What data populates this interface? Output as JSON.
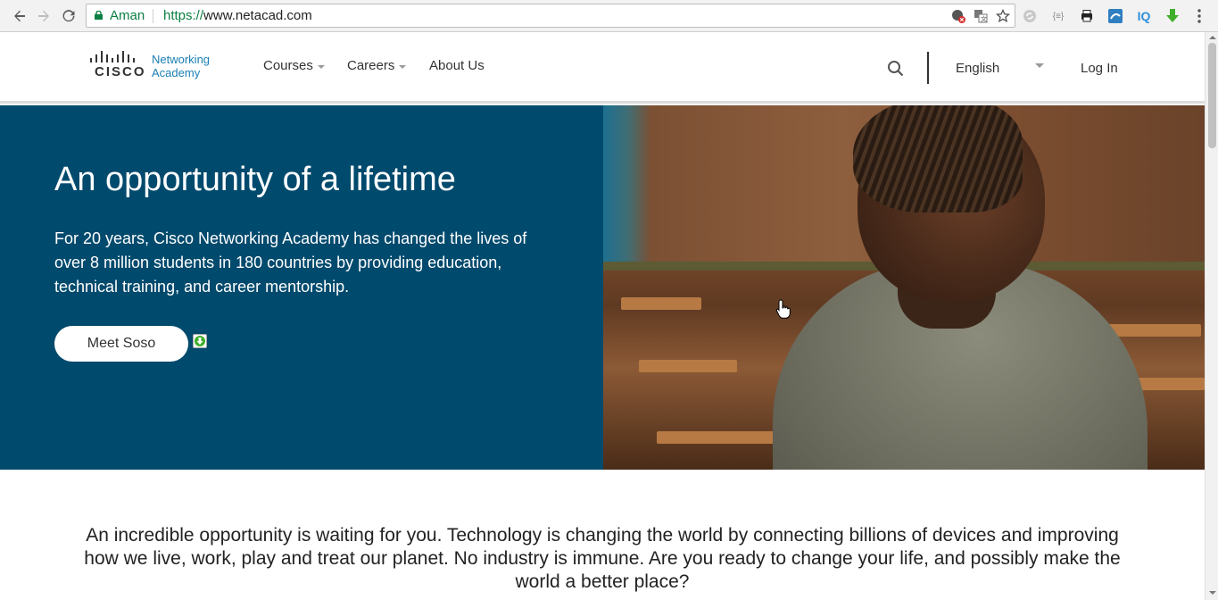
{
  "browser": {
    "secure_label": "Aman",
    "url_scheme": "https://",
    "url_host": "www.netacad.com",
    "icons": [
      "back-icon",
      "forward-icon",
      "reload-icon",
      "lock-icon",
      "site-blocked-icon",
      "translate-icon",
      "bookmark-star-icon"
    ],
    "extensions": [
      "ext-sync-icon",
      "ext-json-icon",
      "ext-print-icon",
      "ext-screenshot-icon",
      "ext-iq-icon",
      "ext-download-icon",
      "menu-kebab-icon"
    ],
    "extension_labels": {
      "json": "{≡}",
      "iq": "IQ"
    }
  },
  "header": {
    "logo_word": "CISCO",
    "logo_sub_line1": "Networking",
    "logo_sub_line2": "Academy",
    "menu": [
      {
        "label": "Courses",
        "has_dropdown": true
      },
      {
        "label": "Careers",
        "has_dropdown": true
      },
      {
        "label": "About Us",
        "has_dropdown": false
      }
    ],
    "language": "English",
    "login": "Log In"
  },
  "hero": {
    "title": "An opportunity of a lifetime",
    "text": "For 20 years, Cisco Networking Academy has changed the lives of over 8 million students in 180 countries by providing education, technical training, and career mentorship.",
    "button_label": "Meet Soso"
  },
  "intro": {
    "text": "An incredible opportunity is waiting for you. Technology is changing the world by connecting billions of devices and improving how we live, work, play and treat our planet. No industry is immune. Are you ready to change your life, and possibly make the world a better place?"
  },
  "colors": {
    "hero_bg": "#004a6d",
    "secure_green": "#0b8043",
    "logo_blue": "#1a7fb4"
  }
}
